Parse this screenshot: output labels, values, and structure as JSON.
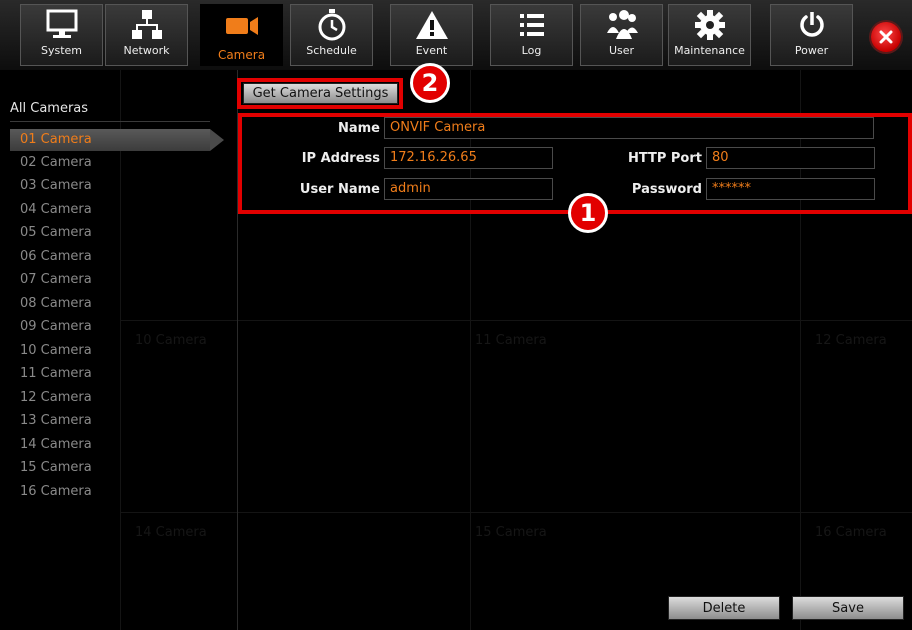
{
  "toolbar": {
    "items": [
      {
        "label": "System",
        "icon": "monitor-icon"
      },
      {
        "label": "Network",
        "icon": "network-icon"
      },
      {
        "label": "Camera",
        "icon": "camera-icon"
      },
      {
        "label": "Schedule",
        "icon": "clock-icon"
      },
      {
        "label": "Event",
        "icon": "warning-icon"
      },
      {
        "label": "Log",
        "icon": "list-icon"
      },
      {
        "label": "User",
        "icon": "users-icon"
      },
      {
        "label": "Maintenance",
        "icon": "gear-icon"
      },
      {
        "label": "Power",
        "icon": "power-icon"
      }
    ],
    "active": "Camera",
    "close_icon": "close-icon"
  },
  "sidebar": {
    "heading": "All Cameras",
    "items": [
      "01 Camera",
      "02 Camera",
      "03 Camera",
      "04 Camera",
      "05 Camera",
      "06 Camera",
      "07 Camera",
      "08 Camera",
      "09 Camera",
      "10 Camera",
      "11 Camera",
      "12 Camera",
      "13 Camera",
      "14 Camera",
      "15 Camera",
      "16 Camera"
    ],
    "selected_index": 0
  },
  "background_tiles": [
    "10 Camera",
    "11 Camera",
    "12 Camera",
    "14 Camera",
    "15 Camera",
    "16 Camera"
  ],
  "form": {
    "get_settings_button": "Get Camera Settings",
    "name_label": "Name",
    "name_value": "ONVIF Camera",
    "ip_label": "IP Address",
    "ip_value": "172.16.26.65",
    "http_port_label": "HTTP Port",
    "http_port_value": "80",
    "username_label": "User Name",
    "username_value": "admin",
    "password_label": "Password",
    "password_value": "******"
  },
  "footer": {
    "delete_button": "Delete",
    "save_button": "Save"
  },
  "annotations": {
    "badge1": "1",
    "badge2": "2"
  },
  "colors": {
    "accent": "#f07d1a",
    "highlight_red": "#e20000"
  }
}
